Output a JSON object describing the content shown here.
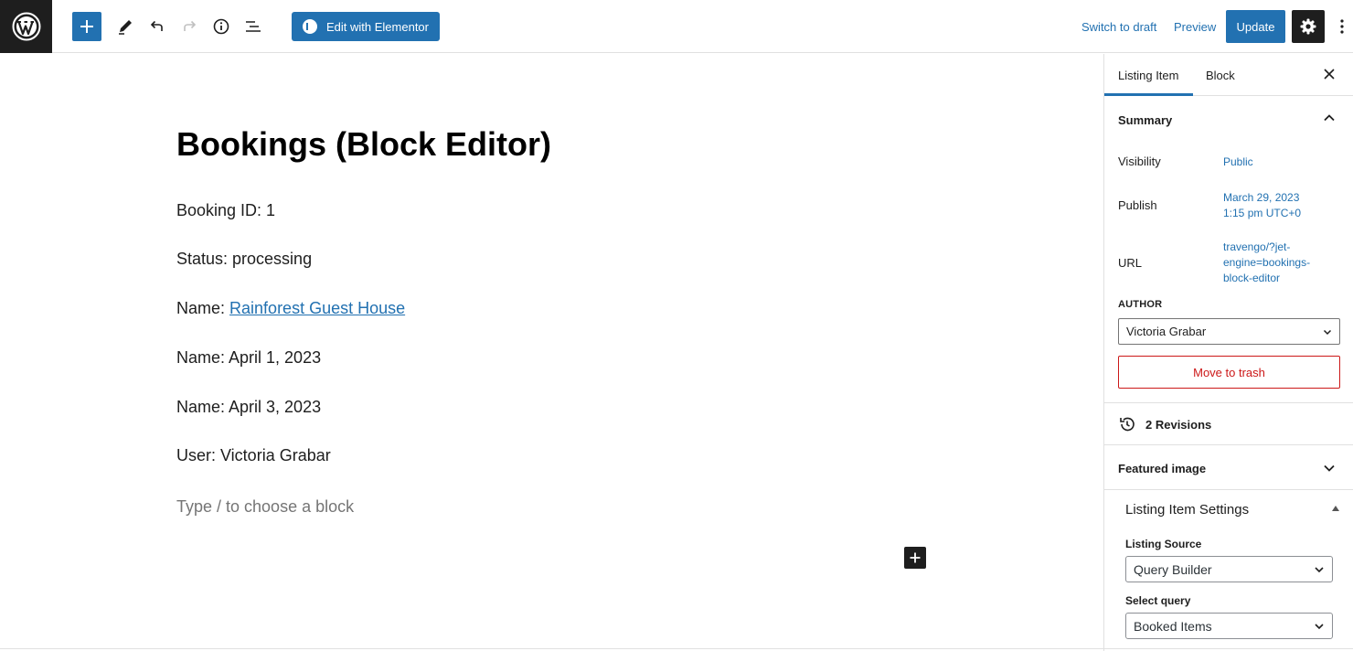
{
  "toolbar": {
    "elementor_label": "Edit with Elementor",
    "switch_to_draft": "Switch to draft",
    "preview": "Preview",
    "update": "Update"
  },
  "post": {
    "title": "Bookings (Block Editor)",
    "lines": {
      "booking_id": "Booking ID: 1",
      "status": "Status: processing",
      "name_prefix": "Name: ",
      "name_link": "Rainforest Guest House",
      "date1": "Name: April 1, 2023",
      "date2": "Name: April 3, 2023",
      "user": "User: Victoria Grabar"
    },
    "placeholder": "Type / to choose a block"
  },
  "sidebar": {
    "tabs": [
      "Listing Item",
      "Block"
    ],
    "summary": {
      "title": "Summary",
      "visibility_label": "Visibility",
      "visibility_value": "Public",
      "publish_label": "Publish",
      "publish_date": "March 29, 2023",
      "publish_time": "1:15 pm UTC+0",
      "url_label": "URL",
      "url_line1": "travengo/?jet-",
      "url_line2": "engine=bookings-",
      "url_line3": "block-editor",
      "author_label": "AUTHOR",
      "author_value": "Victoria Grabar",
      "trash_label": "Move to trash"
    },
    "revisions": "2 Revisions",
    "featured_image": "Featured image",
    "listing_settings": {
      "title": "Listing Item Settings",
      "source_label": "Listing Source",
      "source_value": "Query Builder",
      "query_label": "Select query",
      "query_value": "Booked Items"
    }
  },
  "colors": {
    "accent": "#2271b1",
    "dark": "#1e1e1e",
    "danger": "#cc1818"
  }
}
